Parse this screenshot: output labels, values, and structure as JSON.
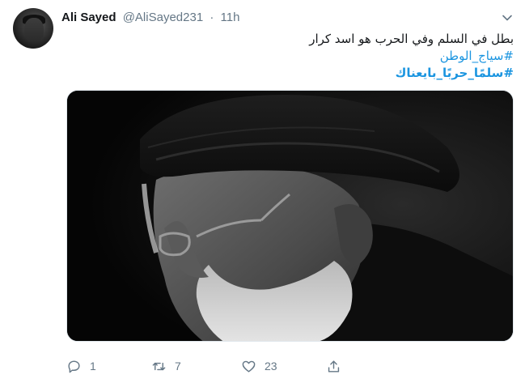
{
  "tweet": {
    "author": {
      "name": "Ali Sayed",
      "handle": "@AliSayed231"
    },
    "separator": "·",
    "time": "11h",
    "text_lines": [
      "بطل في السلم وفي الحرب هو اسد كرار",
      "#سياج_الوطن",
      "#سلمًا_حربًا_بايعناك"
    ],
    "image_alt": "photo-of-man-in-black-turban-and-glasses"
  },
  "actions": {
    "reply_count": "1",
    "retweet_count": "7",
    "like_count": "23"
  },
  "colors": {
    "link": "#1b95e0",
    "muted": "#657786",
    "text": "#14171a"
  }
}
